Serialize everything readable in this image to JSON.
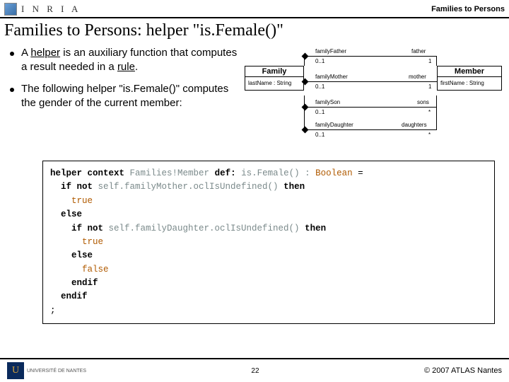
{
  "header": {
    "logo_text": "I N R I A",
    "right_text": "Families to Persons"
  },
  "title": "Families to Persons: helper \"is.Female()\"",
  "bullets": {
    "b1_pre": "A ",
    "b1_u1": "helper",
    "b1_mid": " is an auxiliary function that computes a result needed in a ",
    "b1_u2": "rule",
    "b1_post": ".",
    "b2": "The following helper \"is.Female()\" computes the gender of the current member:"
  },
  "diagram": {
    "family": "Family",
    "family_attr": "lastName : String",
    "member": "Member",
    "member_attr": "firstName : String",
    "assoc": {
      "father_l": "familyFather",
      "father_r": "father",
      "mother_l": "familyMother",
      "mother_r": "mother",
      "son_l": "familySon",
      "son_r": "sons",
      "dau_l": "familyDaughter",
      "dau_r": "daughters",
      "m01": "0..1",
      "m1": "1",
      "mstar": "*"
    }
  },
  "code": {
    "l1a": "helper context ",
    "l1b": "Families!Member",
    "l1c": " def: ",
    "l1d": "is.Female() : ",
    "l1e": "Boolean",
    "l1f": " =",
    "l2a": "  if not ",
    "l2b": "self.familyMother.oclIsUndefined()",
    "l2c": " then",
    "l3": "    true",
    "l4": "  else",
    "l5a": "    if not ",
    "l5b": "self.familyDaughter.oclIsUndefined()",
    "l5c": " then",
    "l6": "      true",
    "l7": "    else",
    "l8": "      false",
    "l9": "    endif",
    "l10": "  endif",
    "l11": ";"
  },
  "footer": {
    "uni_glyph": "U",
    "uni_text": "UNIVERSITÉ DE NANTES",
    "page": "22",
    "copyright": "© 2007 ATLAS Nantes"
  }
}
